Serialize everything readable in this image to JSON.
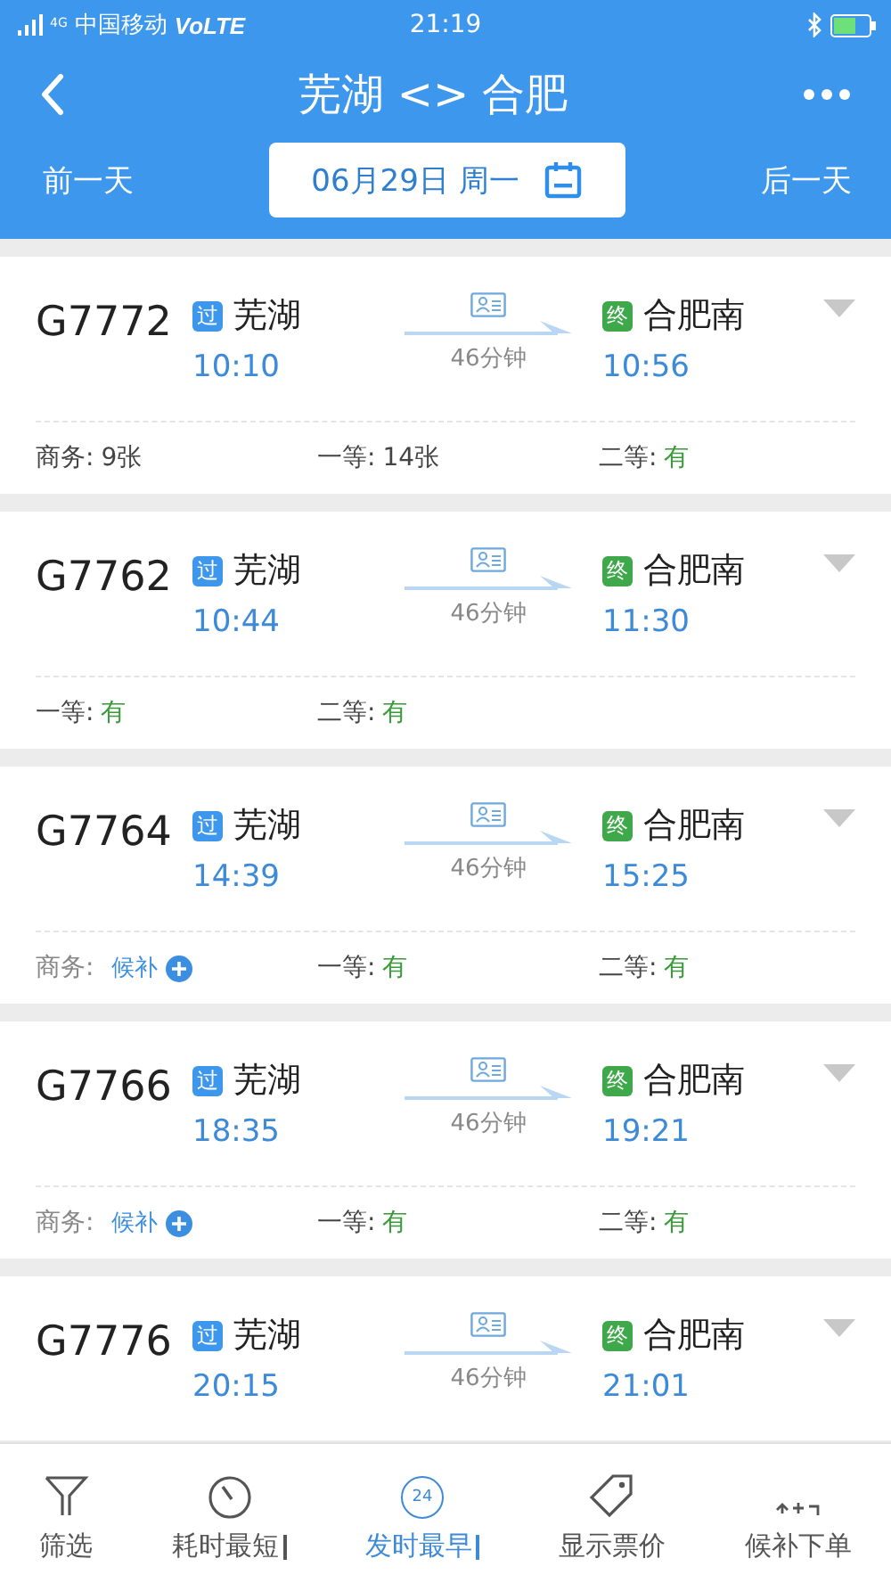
{
  "status_bar": {
    "network": "4G",
    "carrier": "中国移动",
    "volte": "VoLTE",
    "time": "21:19"
  },
  "header": {
    "title": "芜湖 <> 合肥"
  },
  "date_bar": {
    "prev": "前一天",
    "date": "06月29日 周一",
    "next": "后一天"
  },
  "trains": [
    {
      "number": "G7772",
      "from_badge": "过",
      "from": "芜湖",
      "depart": "10:10",
      "duration": "46分钟",
      "to_badge": "终",
      "to": "合肥南",
      "arrive": "10:56",
      "seats": [
        {
          "label": "商务:",
          "value": "9张",
          "kind": "count"
        },
        {
          "label": "一等:",
          "value": "14张",
          "kind": "count"
        },
        {
          "label": "二等:",
          "value": "有",
          "kind": "available"
        }
      ]
    },
    {
      "number": "G7762",
      "from_badge": "过",
      "from": "芜湖",
      "depart": "10:44",
      "duration": "46分钟",
      "to_badge": "终",
      "to": "合肥南",
      "arrive": "11:30",
      "seats": [
        {
          "label": "一等:",
          "value": "有",
          "kind": "available"
        },
        {
          "label": "二等:",
          "value": "有",
          "kind": "available"
        }
      ]
    },
    {
      "number": "G7764",
      "from_badge": "过",
      "from": "芜湖",
      "depart": "14:39",
      "duration": "46分钟",
      "to_badge": "终",
      "to": "合肥南",
      "arrive": "15:25",
      "seats": [
        {
          "label": "商务:",
          "value": "候补",
          "kind": "waitlist"
        },
        {
          "label": "一等:",
          "value": "有",
          "kind": "available"
        },
        {
          "label": "二等:",
          "value": "有",
          "kind": "available"
        }
      ]
    },
    {
      "number": "G7766",
      "from_badge": "过",
      "from": "芜湖",
      "depart": "18:35",
      "duration": "46分钟",
      "to_badge": "终",
      "to": "合肥南",
      "arrive": "19:21",
      "seats": [
        {
          "label": "商务:",
          "value": "候补",
          "kind": "waitlist"
        },
        {
          "label": "一等:",
          "value": "有",
          "kind": "available"
        },
        {
          "label": "二等:",
          "value": "有",
          "kind": "available"
        }
      ]
    },
    {
      "number": "G7776",
      "from_badge": "过",
      "from": "芜湖",
      "depart": "20:15",
      "duration": "46分钟",
      "to_badge": "终",
      "to": "合肥南",
      "arrive": "21:01"
    }
  ],
  "toolbar": [
    {
      "label": "筛选",
      "kind": "filter",
      "selected": false
    },
    {
      "label": "耗时最短",
      "kind": "timer",
      "selected": false,
      "sortable": true
    },
    {
      "label": "发时最早",
      "kind": "clock24",
      "icon_text": "24",
      "selected": true,
      "sortable": true
    },
    {
      "label": "显示票价",
      "kind": "tag",
      "selected": false
    },
    {
      "label": "候补下单",
      "kind": "waitlist",
      "selected": false
    }
  ]
}
